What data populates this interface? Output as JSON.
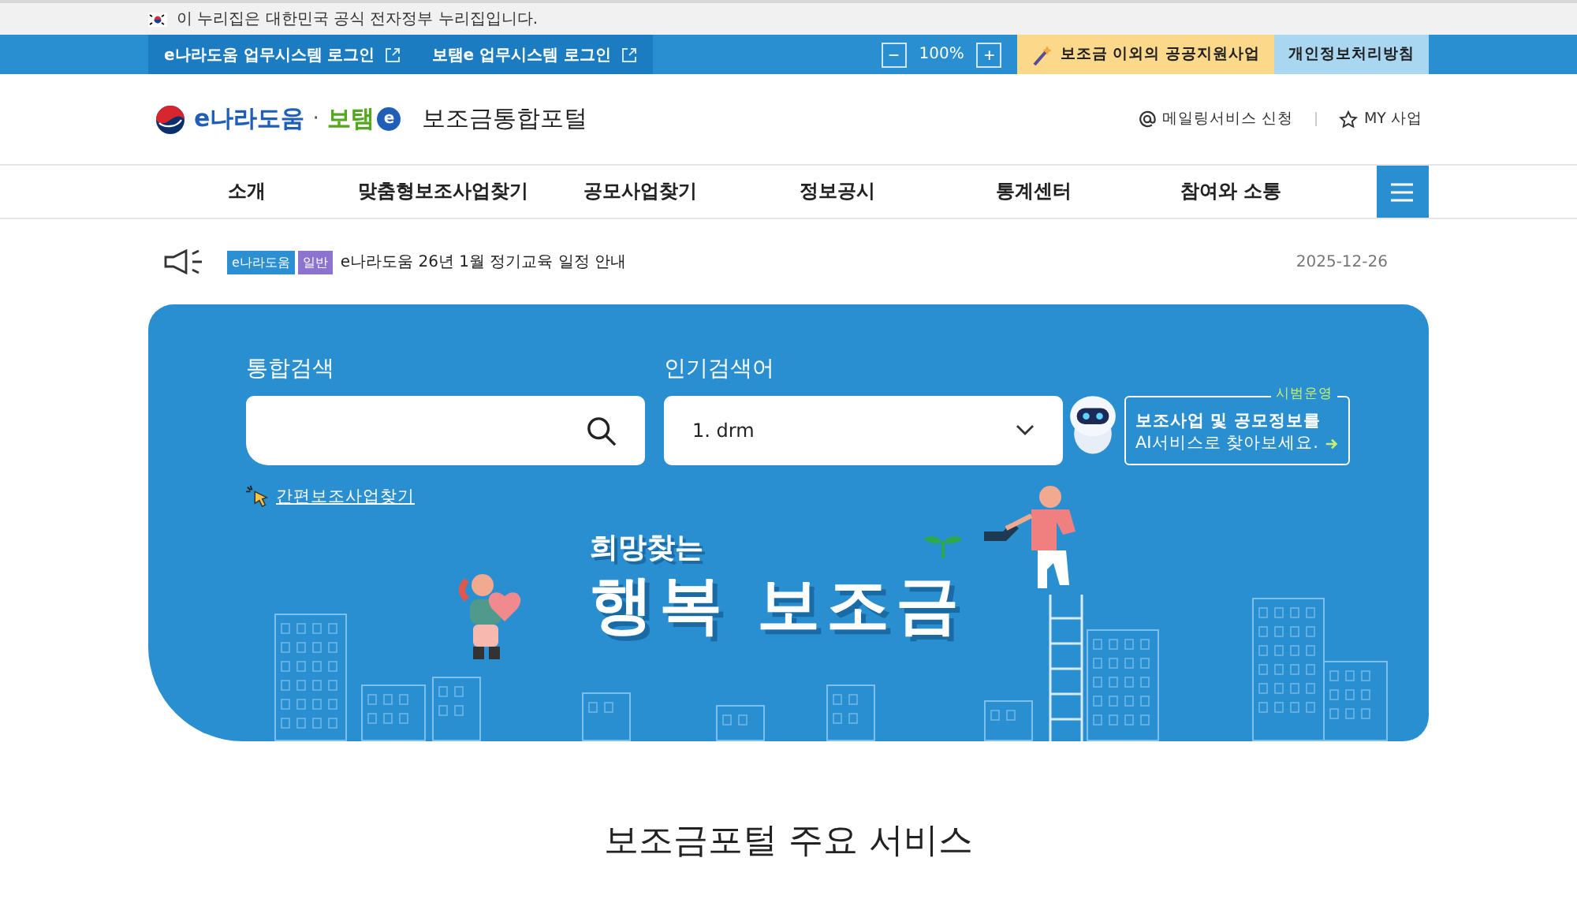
{
  "gov_banner": {
    "text": "이 누리집은 대한민국 공식 전자정부 누리집입니다."
  },
  "top_bar": {
    "system_logins": [
      "e나라도움 업무시스템 로그인",
      "보탬e 업무시스템 로그인"
    ],
    "zoom": {
      "minus": "−",
      "value": "100%",
      "plus": "+"
    },
    "links": [
      {
        "label": "보조금 이외의 공공지원사업",
        "kind": "promo"
      },
      {
        "label": "개인정보처리방침",
        "kind": "privacy"
      }
    ]
  },
  "header": {
    "logo": {
      "brand_1": "e나라도움",
      "separator": "·",
      "brand_2": "보탬",
      "brand_2_badge": "e",
      "title": "보조금통합포털"
    },
    "utility_links": [
      {
        "label": "메일링서비스 신청",
        "kind": "mail"
      },
      {
        "label": "MY 사업",
        "kind": "star"
      }
    ]
  },
  "nav": {
    "items": [
      "소개",
      "맞춤형보조사업찾기",
      "공모사업찾기",
      "정보공시",
      "통계센터",
      "참여와 소통"
    ]
  },
  "notice": {
    "tags": [
      {
        "label": "e나라도움",
        "color": "#2b8fd1"
      },
      {
        "label": "일반",
        "color": "#8b73cf"
      }
    ],
    "title": "e나라도움 26년 1월 정기교육 일정 안내",
    "date": "2025-12-26"
  },
  "hero": {
    "search": {
      "label": "통합검색"
    },
    "popular": {
      "label": "인기검색어",
      "value": "1. drm"
    },
    "ai_banner": {
      "badge": "시범운영",
      "line_1": "보조사업 및 공모정보를",
      "line_2": "AI서비스로 찾아보세요."
    },
    "easy_link": "간편보조사업찾기",
    "slogan_small": "희망찾는",
    "slogan_big": "행복 보조금"
  },
  "section_title": "보조금포털 주요 서비스"
}
